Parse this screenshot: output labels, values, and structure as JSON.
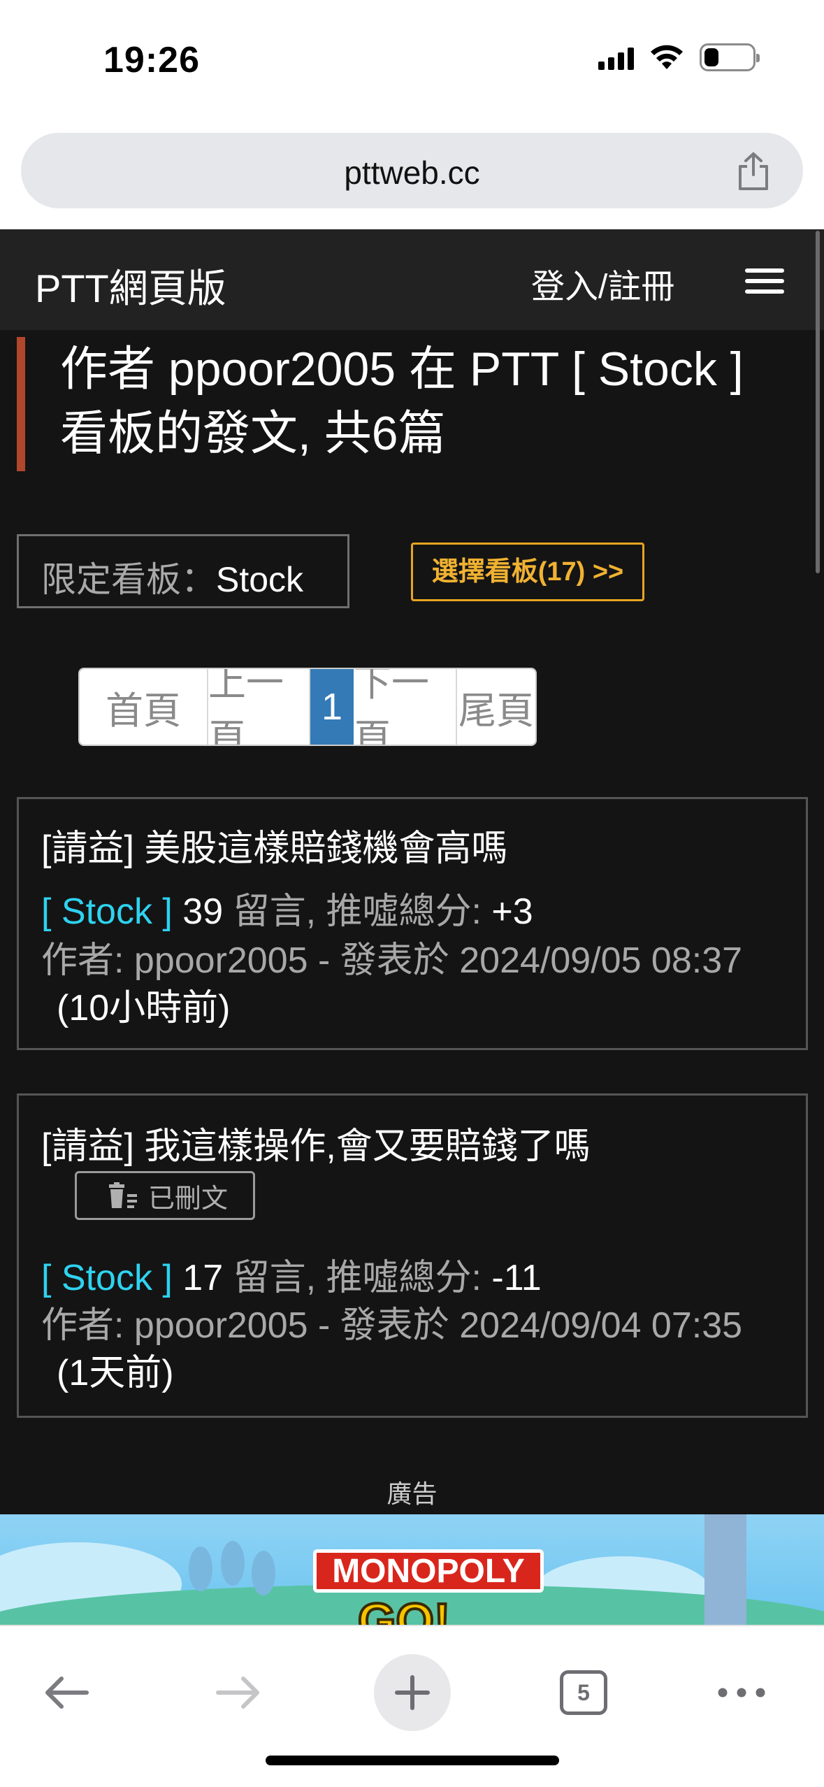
{
  "status_bar": {
    "time": "19:26",
    "battery_level": 0.3
  },
  "browser": {
    "url": "pttweb.cc",
    "tab_count": "5"
  },
  "header": {
    "site_title": "PTT網頁版",
    "login_label": "登入/註冊"
  },
  "heading": {
    "line1": "作者 ppoor2005 在 PTT [ Stock ]",
    "line2": "看板的發文, 共6篇"
  },
  "filter": {
    "label": "限定看板：",
    "board": "Stock",
    "select_label": "選擇看板(17) >>"
  },
  "pagination": {
    "first": "首頁",
    "prev": "上一頁",
    "current": "1",
    "next": "下一頁",
    "last": "尾頁"
  },
  "posts": [
    {
      "title": "[請益] 美股這樣賠錢機會高嗎",
      "board_tag": "[ Stock ]",
      "comments": "39",
      "stats_text": " 留言, 推噓總分: ",
      "score": "+3",
      "author_line": "作者: ppoor2005 - 發表於 2024/09/05 08:37",
      "ago": "(10小時前)"
    },
    {
      "title": "[請益] 我這樣操作,會又要賠錢了嗎",
      "deleted_label": "已刪文",
      "board_tag": "[ Stock ]",
      "comments": "17",
      "stats_text": " 留言, 推噓總分: ",
      "score": "-11",
      "author_line": "作者: ppoor2005 - 發表於 2024/09/04 07:35",
      "ago": "(1天前)"
    }
  ],
  "ad": {
    "label": "廣告",
    "logo_text": "MONOPOLY",
    "logo_sub": "GO!"
  },
  "icons": {
    "signal": "signal-icon",
    "wifi": "wifi-icon",
    "battery": "battery-icon",
    "share": "share-icon",
    "menu": "hamburger-menu-icon",
    "trash": "trash-icon",
    "back": "back-arrow-icon",
    "forward": "forward-arrow-icon",
    "new_tab": "plus-icon",
    "tabs": "tabs-icon",
    "more": "more-icon"
  },
  "colors": {
    "accent_bar": "#b0462c",
    "board_tag": "#2ed3f0",
    "select_border": "#e7a520",
    "page_active": "#337ab7"
  }
}
